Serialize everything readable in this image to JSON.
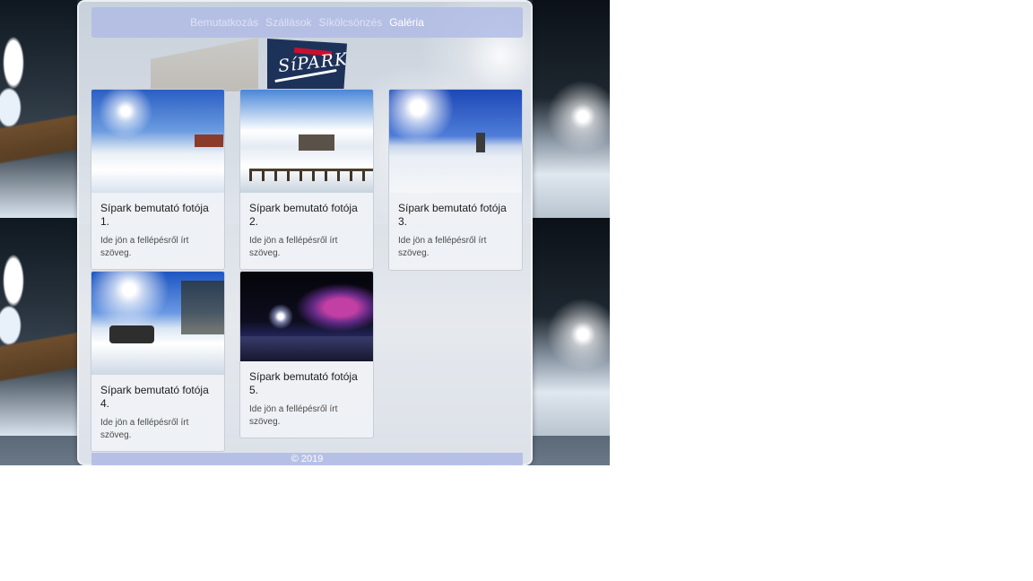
{
  "nav": {
    "items": [
      {
        "label": "Bemutatkozás",
        "active": false
      },
      {
        "label": "Szállások",
        "active": false
      },
      {
        "label": "Síkölcsönzés",
        "active": false
      },
      {
        "label": "Galéria",
        "active": true
      }
    ],
    "active_color": "#ffffff",
    "inactive_color": "#dde3f3"
  },
  "logo": {
    "brand": "SíPARK"
  },
  "gallery": {
    "cards": [
      {
        "title": "Sípark bemutató fotója 1.",
        "text": "Ide jön a fellépésről írt szöveg."
      },
      {
        "title": "Sípark bemutató fotója 2.",
        "text": "Ide jön a fellépésről írt szöveg."
      },
      {
        "title": "Sípark bemutató fotója 3.",
        "text": "Ide jön a fellépésről írt szöveg."
      },
      {
        "title": "Sípark bemutató fotója 4.",
        "text": "Ide jön a fellépésről írt szöveg."
      },
      {
        "title": "Sípark bemutató fotója 5.",
        "text": "Ide jön a fellépésről írt szöveg."
      }
    ]
  },
  "footer": {
    "text": "© 2019"
  },
  "colors": {
    "navbar": "#afbae6",
    "logo_bg": "#1d3259"
  }
}
